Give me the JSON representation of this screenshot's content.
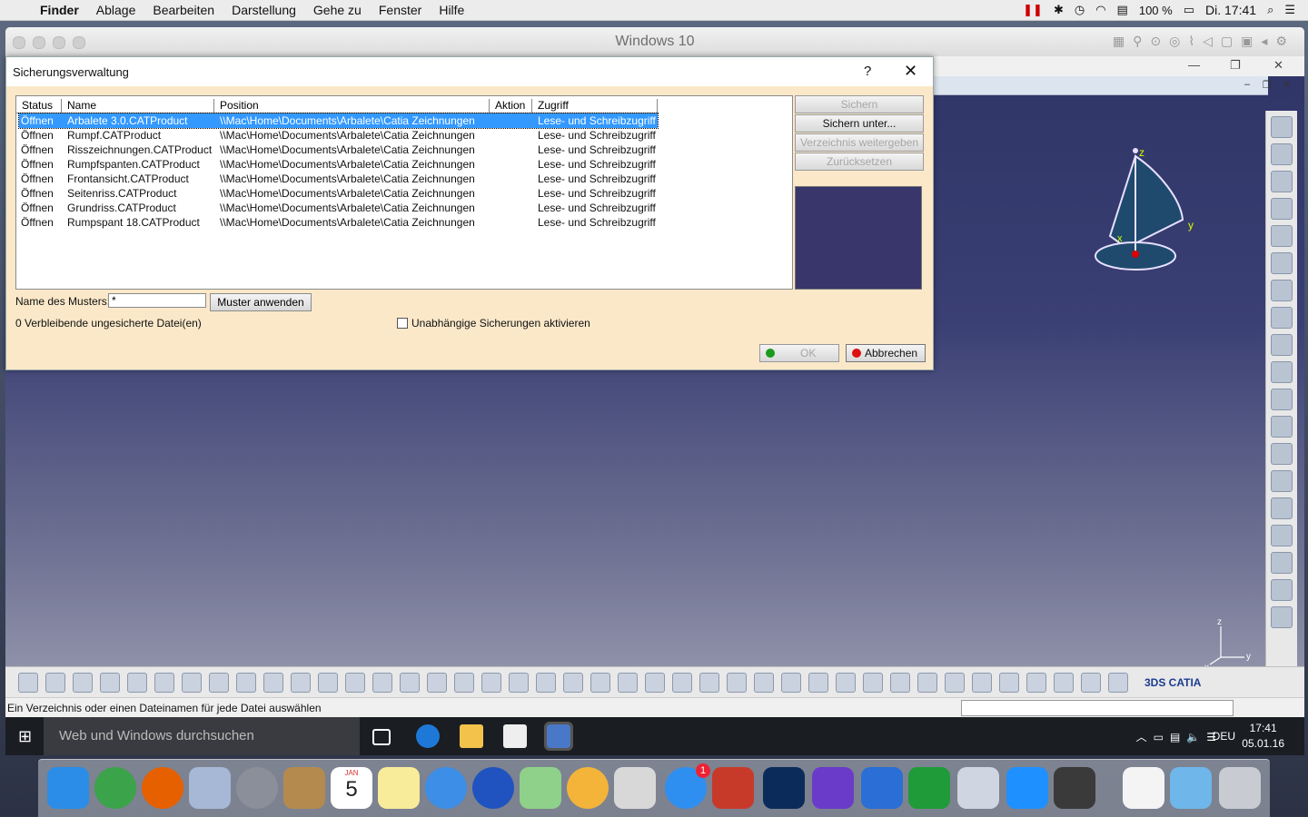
{
  "menubar": {
    "items": [
      "Finder",
      "Ablage",
      "Bearbeiten",
      "Darstellung",
      "Gehe zu",
      "Fenster",
      "Hilfe"
    ],
    "battery": "100 %",
    "clock": "Di. 17:41"
  },
  "vm_window": {
    "title": "Windows 10"
  },
  "dialog": {
    "title": "Sicherungsverwaltung",
    "help_label": "?",
    "close_label": "✕",
    "columns": [
      "Status",
      "Name",
      "Position",
      "Aktion",
      "Zugriff"
    ],
    "rows": [
      {
        "status": "Öffnen",
        "name": "Arbalete 3.0.CATProduct",
        "position": "\\\\Mac\\Home\\Documents\\Arbalete\\Catia Zeichnungen",
        "action": "",
        "access": "Lese- und Schreibzugriff"
      },
      {
        "status": "Öffnen",
        "name": "Rumpf.CATProduct",
        "position": "\\\\Mac\\Home\\Documents\\Arbalete\\Catia Zeichnungen",
        "action": "",
        "access": "Lese- und Schreibzugriff"
      },
      {
        "status": "Öffnen",
        "name": "Risszeichnungen.CATProduct",
        "position": "\\\\Mac\\Home\\Documents\\Arbalete\\Catia Zeichnungen",
        "action": "",
        "access": "Lese- und Schreibzugriff"
      },
      {
        "status": "Öffnen",
        "name": "Rumpfspanten.CATProduct",
        "position": "\\\\Mac\\Home\\Documents\\Arbalete\\Catia Zeichnungen",
        "action": "",
        "access": "Lese- und Schreibzugriff"
      },
      {
        "status": "Öffnen",
        "name": "Frontansicht.CATProduct",
        "position": "\\\\Mac\\Home\\Documents\\Arbalete\\Catia Zeichnungen",
        "action": "",
        "access": "Lese- und Schreibzugriff"
      },
      {
        "status": "Öffnen",
        "name": "Seitenriss.CATProduct",
        "position": "\\\\Mac\\Home\\Documents\\Arbalete\\Catia Zeichnungen",
        "action": "",
        "access": "Lese- und Schreibzugriff"
      },
      {
        "status": "Öffnen",
        "name": "Grundriss.CATProduct",
        "position": "\\\\Mac\\Home\\Documents\\Arbalete\\Catia Zeichnungen",
        "action": "",
        "access": "Lese- und Schreibzugriff"
      },
      {
        "status": "Öffnen",
        "name": "Rumpspant 18.CATProduct",
        "position": "\\\\Mac\\Home\\Documents\\Arbalete\\Catia Zeichnungen",
        "action": "",
        "access": "Lese- und Schreibzugriff"
      }
    ],
    "buttons": {
      "save": "Sichern",
      "save_as": "Sichern unter...",
      "propagate_dir": "Verzeichnis weitergeben",
      "reset": "Zurücksetzen",
      "apply_pattern": "Muster anwenden",
      "ok": "OK",
      "cancel": "Abbrechen"
    },
    "pattern_label": "Name des Musters:",
    "pattern_value": "*",
    "remaining": "0 Verbleibende ungesicherte Datei(en)",
    "independent_label": "Unabhängige Sicherungen aktivieren"
  },
  "catia": {
    "statusbar": "Ein Verzeichnis oder einen Dateinamen für jede Datei auswählen",
    "compass_x": "x",
    "compass_y": "y",
    "compass_z": "z"
  },
  "taskbar": {
    "search_placeholder": "Web und Windows durchsuchen",
    "lang": "DEU",
    "time": "17:41",
    "date": "05.01.16"
  },
  "dock": {
    "calendar_month": "JAN",
    "calendar_day": "5",
    "appstore_badge": "1"
  }
}
